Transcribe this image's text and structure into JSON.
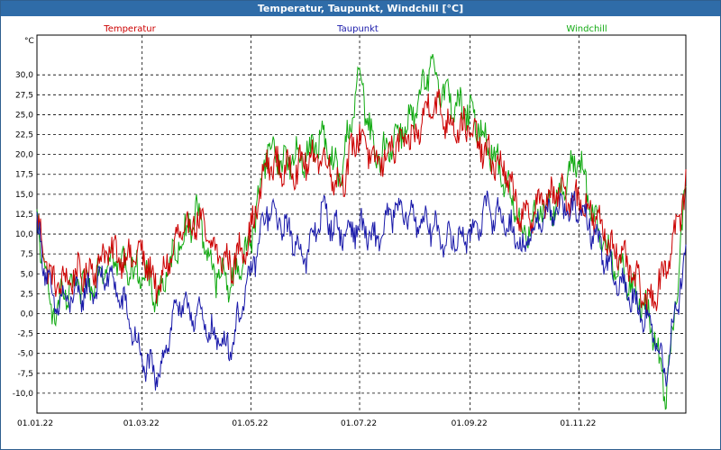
{
  "window": {
    "title": "Temperatur, Taupunkt, Windchill [°C]"
  },
  "chart_data": {
    "type": "line",
    "title": "Temperatur, Taupunkt, Windchill [°C]",
    "ylabel": "°C",
    "ylim": [
      -12.5,
      35
    ],
    "yticks": [
      -10.0,
      -7.5,
      -5.0,
      -2.5,
      0.0,
      2.5,
      5.0,
      7.5,
      10.0,
      12.5,
      15.0,
      17.5,
      20.0,
      22.5,
      25.0,
      27.5,
      30.0
    ],
    "ytick_labels": [
      "-10,0",
      "-7,5",
      "-5,0",
      "-2,5",
      "0,0",
      "2,5",
      "5,0",
      "7,5",
      "10,0",
      "12,5",
      "15,0",
      "17,5",
      "20,0",
      "22,5",
      "25,0",
      "27,5",
      "30,0"
    ],
    "x_dates": [
      "2022-01-01",
      "2022-03-01",
      "2022-05-01",
      "2022-07-01",
      "2022-09-01",
      "2022-11-01"
    ],
    "xtick_labels": [
      "01.01.22",
      "01.03.22",
      "01.05.22",
      "01.07.22",
      "01.09.22",
      "01.11.22"
    ],
    "xlim": [
      "2022-01-01",
      "2022-12-31"
    ],
    "grid": true,
    "legend_position": "top",
    "series": [
      {
        "name": "Temperatur",
        "color": "#cc0000",
        "x": [
          "2022-01-01",
          "2022-01-10",
          "2022-01-20",
          "2022-02-01",
          "2022-02-10",
          "2022-02-20",
          "2022-03-01",
          "2022-03-10",
          "2022-03-20",
          "2022-04-01",
          "2022-04-10",
          "2022-04-20",
          "2022-05-01",
          "2022-05-10",
          "2022-05-20",
          "2022-06-01",
          "2022-06-10",
          "2022-06-20",
          "2022-07-01",
          "2022-07-10",
          "2022-07-20",
          "2022-08-01",
          "2022-08-10",
          "2022-08-20",
          "2022-09-01",
          "2022-09-10",
          "2022-09-20",
          "2022-10-01",
          "2022-10-10",
          "2022-10-20",
          "2022-11-01",
          "2022-11-10",
          "2022-11-20",
          "2022-12-01",
          "2022-12-10",
          "2022-12-20",
          "2022-12-31"
        ],
        "values": [
          11.5,
          3.5,
          4.5,
          5.5,
          8.0,
          7.0,
          7.5,
          3.0,
          9.0,
          12.0,
          8.0,
          6.0,
          10.0,
          19.0,
          18.0,
          19.0,
          20.0,
          16.0,
          23.0,
          18.5,
          21.0,
          22.0,
          27.0,
          24.0,
          23.0,
          20.0,
          18.0,
          11.5,
          14.0,
          15.0,
          14.5,
          12.0,
          8.5,
          5.0,
          1.0,
          6.0,
          15.5
        ]
      },
      {
        "name": "Taupunkt",
        "color": "#1a1aaa",
        "x": [
          "2022-01-01",
          "2022-01-10",
          "2022-01-20",
          "2022-02-01",
          "2022-02-10",
          "2022-02-20",
          "2022-03-01",
          "2022-03-10",
          "2022-03-20",
          "2022-04-01",
          "2022-04-10",
          "2022-04-20",
          "2022-05-01",
          "2022-05-10",
          "2022-05-20",
          "2022-06-01",
          "2022-06-10",
          "2022-06-20",
          "2022-07-01",
          "2022-07-10",
          "2022-07-20",
          "2022-08-01",
          "2022-08-10",
          "2022-08-20",
          "2022-09-01",
          "2022-09-10",
          "2022-09-20",
          "2022-10-01",
          "2022-10-10",
          "2022-10-20",
          "2022-11-01",
          "2022-11-10",
          "2022-11-20",
          "2022-12-01",
          "2022-12-10",
          "2022-12-20",
          "2022-12-31"
        ],
        "values": [
          11.0,
          1.0,
          2.0,
          3.0,
          5.0,
          0.5,
          -6.0,
          -8.0,
          1.0,
          0.0,
          -3.0,
          -4.0,
          5.0,
          13.0,
          11.0,
          7.0,
          13.0,
          10.0,
          11.0,
          9.0,
          13.0,
          12.0,
          11.0,
          9.0,
          10.0,
          13.0,
          12.0,
          8.0,
          12.0,
          13.0,
          13.0,
          10.0,
          5.0,
          2.0,
          -1.0,
          -7.0,
          8.0
        ]
      },
      {
        "name": "Windchill",
        "color": "#11aa11",
        "x": [
          "2022-01-01",
          "2022-01-10",
          "2022-01-20",
          "2022-02-01",
          "2022-02-10",
          "2022-02-20",
          "2022-03-01",
          "2022-03-10",
          "2022-03-20",
          "2022-04-01",
          "2022-04-10",
          "2022-04-20",
          "2022-05-01",
          "2022-05-10",
          "2022-05-20",
          "2022-06-01",
          "2022-06-10",
          "2022-06-20",
          "2022-07-01",
          "2022-07-10",
          "2022-07-20",
          "2022-08-01",
          "2022-08-10",
          "2022-08-20",
          "2022-09-01",
          "2022-09-10",
          "2022-09-20",
          "2022-10-01",
          "2022-10-10",
          "2022-10-20",
          "2022-11-01",
          "2022-11-10",
          "2022-11-20",
          "2022-12-01",
          "2022-12-10",
          "2022-12-20",
          "2022-12-31"
        ],
        "values": [
          11.0,
          0.0,
          3.0,
          4.0,
          7.0,
          6.0,
          5.0,
          2.0,
          8.0,
          13.0,
          5.0,
          4.0,
          9.0,
          21.0,
          19.0,
          20.0,
          22.0,
          17.0,
          30.0,
          19.0,
          22.0,
          25.0,
          31.0,
          27.0,
          25.0,
          22.0,
          17.0,
          10.0,
          13.0,
          14.0,
          20.0,
          11.0,
          7.0,
          3.0,
          0.0,
          -10.0,
          15.0
        ]
      }
    ]
  }
}
